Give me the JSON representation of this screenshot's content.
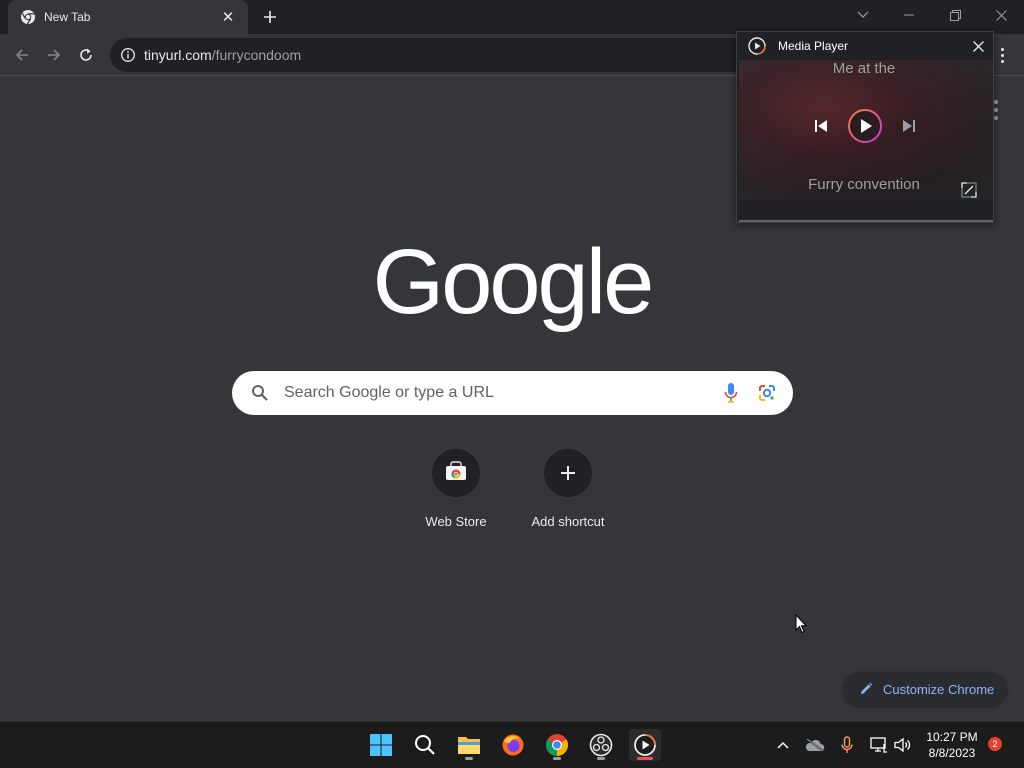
{
  "tab": {
    "title": "New Tab",
    "close_glyph": "✕"
  },
  "address_bar": {
    "domain": "tinyurl.com",
    "path": "/furrycondoom"
  },
  "page": {
    "logo": "Google",
    "search_placeholder": "Search Google or type a URL",
    "shortcuts": [
      {
        "label": "Web Store",
        "icon": "web-store-icon"
      },
      {
        "label": "Add shortcut",
        "icon": "plus-icon"
      }
    ],
    "customize_label": "Customize Chrome"
  },
  "media_player": {
    "title": "Media Player",
    "lyric_top": "Me at the",
    "lyric_bottom": "Furry convention"
  },
  "taskbar": {
    "time": "10:27 PM",
    "date": "8/8/2023",
    "notification_count": "2"
  },
  "colors": {
    "page_bg": "#35363a",
    "frame_bg": "#202124",
    "accent_link": "#8ab4f8",
    "active_indicator": "#ff4b4b"
  }
}
